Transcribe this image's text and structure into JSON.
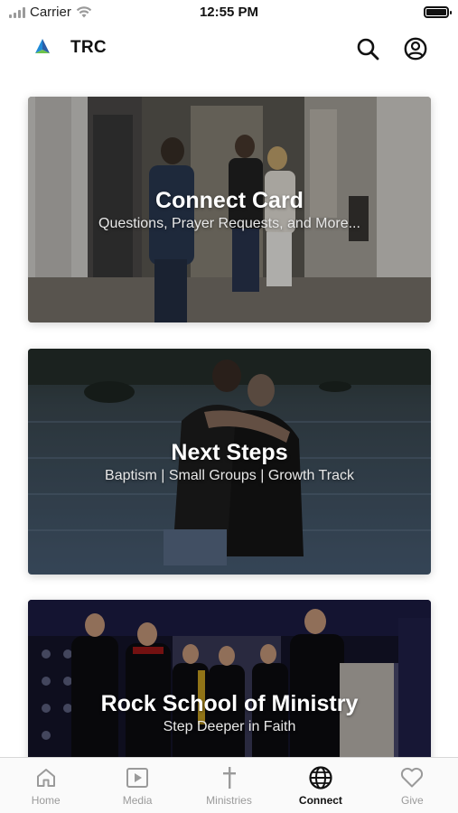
{
  "status_bar": {
    "carrier": "Carrier",
    "time": "12:55 PM",
    "battery_level": 1.0,
    "wifi_icon": "wifi-icon",
    "signal_icon": "cellular-signal-icon"
  },
  "header": {
    "title": "TRC",
    "logo_icon": "trc-triangle-logo",
    "search_icon": "search-icon",
    "profile_icon": "user-profile-icon"
  },
  "cards": [
    {
      "title": "Connect Card",
      "subtitle": "Questions, Prayer Requests, and More..."
    },
    {
      "title": "Next Steps",
      "subtitle": "Baptism | Small Groups | Growth Track"
    },
    {
      "title": "Rock School of Ministry",
      "subtitle": "Step Deeper in Faith"
    }
  ],
  "tabs": [
    {
      "label": "Home",
      "icon": "home-icon",
      "active": false
    },
    {
      "label": "Media",
      "icon": "play-square-icon",
      "active": false
    },
    {
      "label": "Ministries",
      "icon": "cross-icon",
      "active": false
    },
    {
      "label": "Connect",
      "icon": "globe-icon",
      "active": true
    },
    {
      "label": "Give",
      "icon": "heart-icon",
      "active": false
    }
  ],
  "colors": {
    "accent": "#111111",
    "inactive": "#9a9a9a",
    "logo_blue": "#1f8ad8",
    "logo_green": "#6cc24a"
  }
}
